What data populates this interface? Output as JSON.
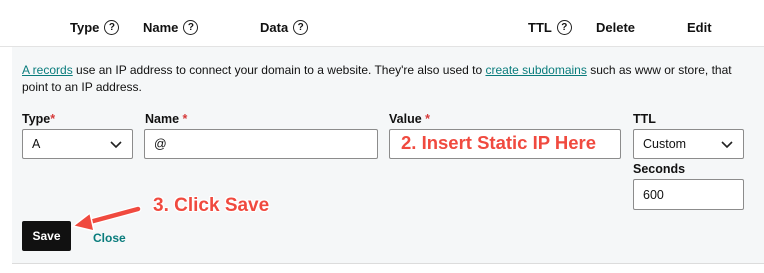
{
  "header": {
    "columns": [
      {
        "label": "Type",
        "help": "?"
      },
      {
        "label": "Name",
        "help": "?"
      },
      {
        "label": "Data",
        "help": "?"
      },
      {
        "label": "TTL",
        "help": "?"
      },
      {
        "label": "Delete"
      },
      {
        "label": "Edit"
      }
    ]
  },
  "description": {
    "link1": "A records",
    "text1": " use an IP address to connect your domain to a website. They're also used to ",
    "link2": "create subdomains",
    "text2": " such as www or store, that point to an IP address."
  },
  "form": {
    "type_label": "Type",
    "type_value": "A",
    "name_label": "Name",
    "name_value": "@",
    "value_label": "Value",
    "value_value": "",
    "ttl_label": "TTL",
    "ttl_value": "Custom",
    "seconds_label": "Seconds",
    "seconds_value": "600",
    "required_mark": "*"
  },
  "actions": {
    "save_label": "Save",
    "close_label": "Close"
  },
  "annotations": {
    "insert_ip": "2. Insert Static IP Here",
    "click_save": "3. Click Save"
  },
  "colors": {
    "accent_link": "#097c7c",
    "annotation": "#f04a3f",
    "required": "#d63a3a",
    "save_bg": "#111111"
  }
}
